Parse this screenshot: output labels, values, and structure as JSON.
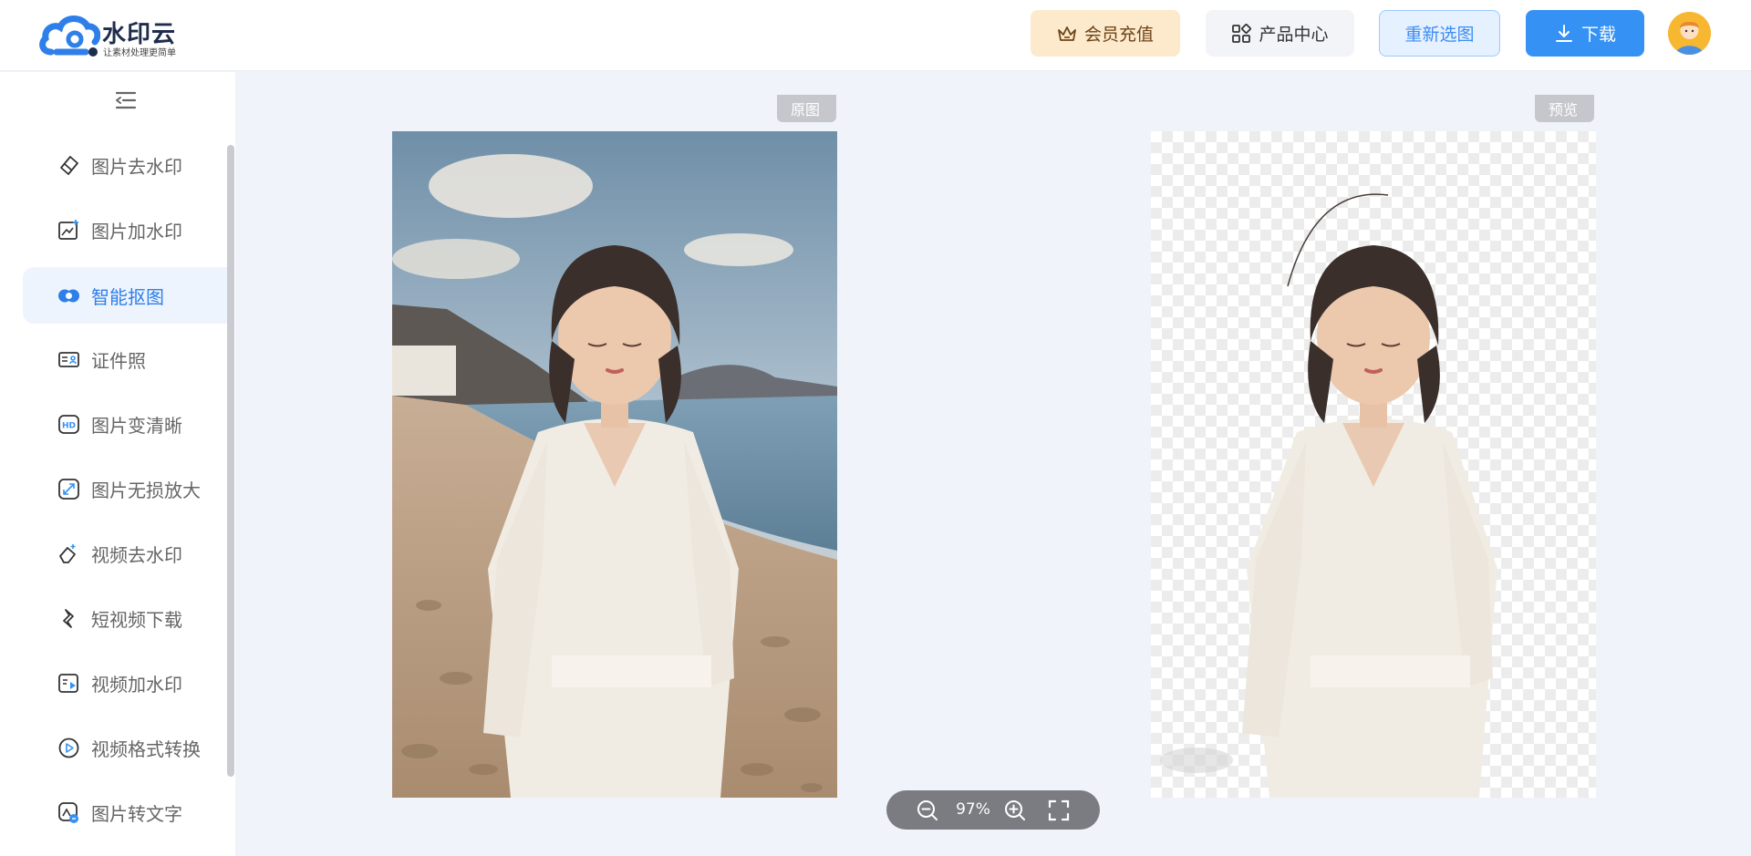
{
  "app": {
    "brand": "水印云",
    "slogan": "让素材处理更简单"
  },
  "header": {
    "vip_label": "会员充值",
    "product_label": "产品中心",
    "reselect_label": "重新选图",
    "download_label": "下载",
    "colors": {
      "vip_bg": "#fde9cc",
      "download_bg": "#3592f4",
      "accent": "#2e7fe9"
    }
  },
  "sidebar": {
    "collapse_icon": "collapse-menu-icon",
    "items": [
      {
        "label": "图片去水印",
        "icon": "eraser-icon",
        "active": false
      },
      {
        "label": "图片加水印",
        "icon": "image-add-icon",
        "active": false
      },
      {
        "label": "智能抠图",
        "icon": "cutout-icon",
        "active": true
      },
      {
        "label": "证件照",
        "icon": "id-card-icon",
        "active": false
      },
      {
        "label": "图片变清晰",
        "icon": "hd-icon",
        "active": false
      },
      {
        "label": "图片无损放大",
        "icon": "enlarge-icon",
        "active": false
      },
      {
        "label": "视频去水印",
        "icon": "video-eraser-icon",
        "active": false
      },
      {
        "label": "短视频下载",
        "icon": "video-download-icon",
        "active": false
      },
      {
        "label": "视频加水印",
        "icon": "video-watermark-icon",
        "active": false
      },
      {
        "label": "视频格式转换",
        "icon": "video-convert-icon",
        "active": false
      },
      {
        "label": "图片转文字",
        "icon": "ocr-icon",
        "active": false
      }
    ]
  },
  "workspace": {
    "original_tag": "原图",
    "preview_tag": "预览",
    "zoom": "97%"
  }
}
